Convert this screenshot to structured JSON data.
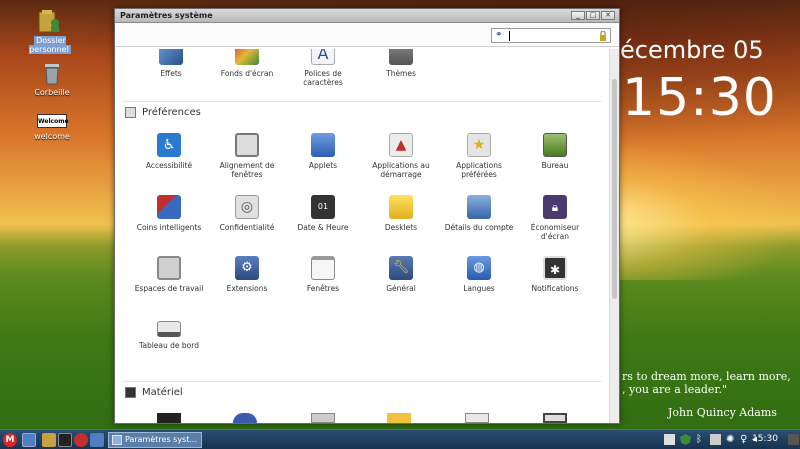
{
  "desktop": {
    "icons": [
      {
        "label": "Dossier personnel"
      },
      {
        "label": "Corbeille"
      },
      {
        "label": "welcome",
        "badge": "Welcome"
      }
    ],
    "clock_date": "écembre 05",
    "clock_time": "15:30",
    "quote_line1": "rs to dream more, learn more,",
    "quote_line2": ", you are a leader.\"",
    "quote_author": "John Quincy Adams"
  },
  "window": {
    "title": "Paramètres système",
    "buttons": [
      "_",
      "□",
      "✕"
    ],
    "search": {
      "value": "",
      "icon": "search-binoculars-icon"
    },
    "top_row": [
      {
        "label": "Effets",
        "icon": "effects-icon"
      },
      {
        "label": "Fonds d'écran",
        "icon": "wallpaper-icon"
      },
      {
        "label": "Polices de caractères",
        "icon": "fonts-icon"
      },
      {
        "label": "Thèmes",
        "icon": "themes-icon"
      }
    ],
    "preferences": {
      "title": "Préférences",
      "items": [
        {
          "label": "Accessibilité",
          "icon": "accessibility-icon"
        },
        {
          "label": "Alignement de fenêtres",
          "icon": "window-tiling-icon"
        },
        {
          "label": "Applets",
          "icon": "applets-icon"
        },
        {
          "label": "Applications au démarrage",
          "icon": "startup-apps-icon"
        },
        {
          "label": "Applications préférées",
          "icon": "preferred-apps-icon"
        },
        {
          "label": "Bureau",
          "icon": "desktop-icon"
        },
        {
          "label": "Coins intelligents",
          "icon": "hot-corners-icon"
        },
        {
          "label": "Confidentialité",
          "icon": "privacy-icon"
        },
        {
          "label": "Date & Heure",
          "icon": "date-time-icon"
        },
        {
          "label": "Desklets",
          "icon": "desklets-icon"
        },
        {
          "label": "Détails du compte",
          "icon": "account-icon"
        },
        {
          "label": "Économiseur d'écran",
          "icon": "screensaver-icon"
        },
        {
          "label": "Espaces de travail",
          "icon": "workspaces-icon"
        },
        {
          "label": "Extensions",
          "icon": "extensions-icon"
        },
        {
          "label": "Fenêtres",
          "icon": "windows-icon"
        },
        {
          "label": "Général",
          "icon": "general-icon"
        },
        {
          "label": "Langues",
          "icon": "languages-icon"
        },
        {
          "label": "Notifications",
          "icon": "notifications-icon"
        },
        {
          "label": "Tableau de bord",
          "icon": "panel-icon"
        }
      ]
    },
    "hardware": {
      "title": "Matériel"
    }
  },
  "taskbar": {
    "task_label": "Paramètres syst...",
    "clock": "15:30"
  },
  "colors": {
    "accent": "#5b7ea6",
    "panel": "#173450"
  }
}
